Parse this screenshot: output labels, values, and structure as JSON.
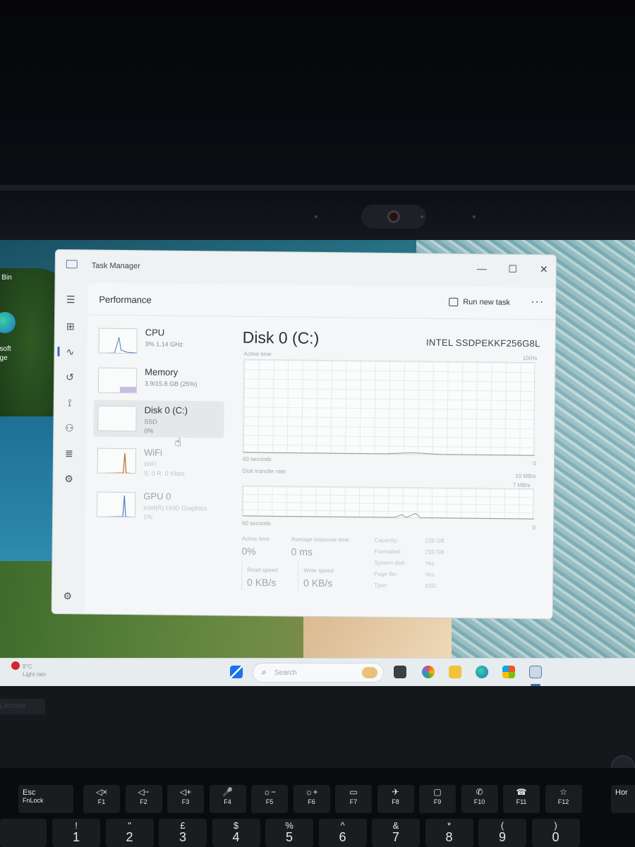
{
  "desktop": {
    "recycle_bin_label": "e Bin",
    "edge_label_1": "osoft",
    "edge_label_2": "dge"
  },
  "window": {
    "title": "Task Manager",
    "minimize": "—",
    "maximize": "☐",
    "close": "✕"
  },
  "commandbar": {
    "page_title": "Performance",
    "run_new_task": "Run new task",
    "more": "···"
  },
  "devices": [
    {
      "name": "CPU",
      "sub1": "3% 1.14 GHz",
      "sub2": ""
    },
    {
      "name": "Memory",
      "sub1": "3.9/15.8 GB (25%)",
      "sub2": ""
    },
    {
      "name": "Disk 0 (C:)",
      "sub1": "SSD",
      "sub2": "0%"
    },
    {
      "name": "WiFi",
      "sub1": "WiFi",
      "sub2": "S: 0 R: 0 Kbps"
    },
    {
      "name": "GPU 0",
      "sub1": "Intel(R) UHD Graphics",
      "sub2": "1%"
    }
  ],
  "disk": {
    "title": "Disk 0 (C:)",
    "model": "INTEL SSDPEKKF256G8L",
    "active_time_label": "Active time",
    "active_time_max": "100%",
    "g1_time": "60 seconds",
    "g1_min": "0",
    "transfer_label": "Disk transfer rate",
    "transfer_max": "10 MB/s",
    "transfer_mid": "7 MB/s",
    "g2_time": "60 seconds",
    "g2_min": "0",
    "stats": {
      "active_time_label": "Active time",
      "active_time_value": "0%",
      "avg_response_label": "Average response time",
      "avg_response_value": "0 ms",
      "read_label": "Read speed",
      "read_value": "0 KB/s",
      "write_label": "Write speed",
      "write_value": "0 KB/s"
    },
    "specs": [
      {
        "key": "Capacity:",
        "value": "239 GB"
      },
      {
        "key": "Formatted:",
        "value": "239 GB"
      },
      {
        "key": "System disk:",
        "value": "Yes"
      },
      {
        "key": "Page file:",
        "value": "Yes"
      },
      {
        "key": "Type:",
        "value": "SSD"
      }
    ]
  },
  "taskbar": {
    "weather_temp": "9°C",
    "weather_desc": "Light rain",
    "search_placeholder": "Search"
  },
  "keyboard": {
    "brand": "Lenovo",
    "esc": "Esc",
    "fnlock": "FnLock",
    "fkeys": [
      "F1",
      "F2",
      "F3",
      "F4",
      "F5",
      "F6",
      "F7",
      "F8",
      "F9",
      "F10",
      "F11",
      "F12"
    ],
    "hor": "Hor",
    "numbers": [
      {
        "top": "!",
        "bot": "1"
      },
      {
        "top": "\"",
        "bot": "2"
      },
      {
        "top": "£",
        "bot": "3"
      },
      {
        "top": "$",
        "bot": "4"
      },
      {
        "top": "%",
        "bot": "5"
      },
      {
        "top": "^",
        "bot": "6"
      },
      {
        "top": "&",
        "bot": "7"
      },
      {
        "top": "*",
        "bot": "8"
      },
      {
        "top": "(",
        "bot": "9"
      },
      {
        "top": ")",
        "bot": "0"
      }
    ]
  },
  "colors": {
    "accent": "#3d6cb3",
    "cpu_graph": "#4a7fc4",
    "wifi_graph": "#c8642a",
    "gpu_graph": "#4a7fc4"
  }
}
